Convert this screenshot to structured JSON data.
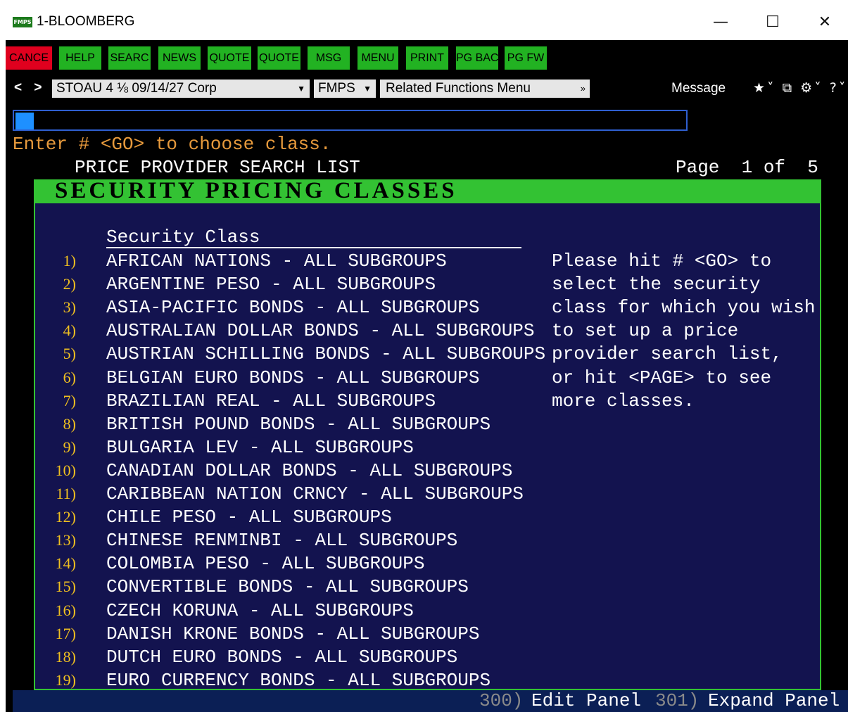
{
  "window": {
    "title": "1-BLOOMBERG",
    "icon_text": "FMPS",
    "controls": {
      "minimize": "—",
      "maximize": "☐",
      "close": "✕"
    }
  },
  "toolbar": {
    "buttons": [
      "CANCE",
      "HELP",
      "SEARC",
      "NEWS",
      "QUOTE",
      "QUOTE",
      "MSG",
      "MENU",
      "PRINT",
      "PG BAC",
      "PG FW"
    ]
  },
  "navbar": {
    "arrows": "< >",
    "security": "STOAU 4 ⅛ 09/14/27 Corp",
    "function": "FMPS",
    "related": "Related Functions  Menu",
    "message": "Message",
    "icons": "★˅ ⧉ ⚙˅ ?˅"
  },
  "screen": {
    "prompt": "Enter # <GO> to choose class.",
    "subtitle": "PRICE PROVIDER SEARCH LIST",
    "page_info": "Page  1 of  5",
    "banner": "SECURITY PRICING CLASSES",
    "column_header": "Security Class",
    "classes": [
      {
        "num": "1)",
        "label": "AFRICAN NATIONS - ALL SUBGROUPS"
      },
      {
        "num": "2)",
        "label": "ARGENTINE PESO - ALL SUBGROUPS"
      },
      {
        "num": "3)",
        "label": "ASIA-PACIFIC BONDS - ALL SUBGROUPS"
      },
      {
        "num": "4)",
        "label": "AUSTRALIAN DOLLAR BONDS - ALL SUBGROUPS"
      },
      {
        "num": "5)",
        "label": "AUSTRIAN SCHILLING BONDS - ALL SUBGROUPS"
      },
      {
        "num": "6)",
        "label": "BELGIAN EURO BONDS - ALL SUBGROUPS"
      },
      {
        "num": "7)",
        "label": "BRAZILIAN REAL - ALL SUBGROUPS"
      },
      {
        "num": "8)",
        "label": "BRITISH POUND BONDS - ALL SUBGROUPS"
      },
      {
        "num": "9)",
        "label": "BULGARIA LEV - ALL SUBGROUPS"
      },
      {
        "num": "10)",
        "label": "CANADIAN DOLLAR BONDS - ALL SUBGROUPS"
      },
      {
        "num": "11)",
        "label": "CARIBBEAN NATION CRNCY - ALL SUBGROUPS"
      },
      {
        "num": "12)",
        "label": "CHILE PESO - ALL SUBGROUPS"
      },
      {
        "num": "13)",
        "label": "CHINESE RENMINBI - ALL SUBGROUPS"
      },
      {
        "num": "14)",
        "label": "COLOMBIA PESO - ALL SUBGROUPS"
      },
      {
        "num": "15)",
        "label": "CONVERTIBLE BONDS - ALL SUBGROUPS"
      },
      {
        "num": "16)",
        "label": "CZECH KORUNA - ALL SUBGROUPS"
      },
      {
        "num": "17)",
        "label": "DANISH KRONE BONDS - ALL SUBGROUPS"
      },
      {
        "num": "18)",
        "label": "DUTCH EURO BONDS - ALL SUBGROUPS"
      },
      {
        "num": "19)",
        "label": "EURO CURRENCY BONDS - ALL SUBGROUPS"
      }
    ],
    "help_lines": [
      "Please hit # <GO> to",
      "select the security",
      "class for which you wish",
      "to set up a price",
      "provider search list,",
      "or hit <PAGE> to see",
      "more classes."
    ]
  },
  "footer": {
    "edit_num": "300)",
    "edit_label": "Edit Panel",
    "expand_num": "301)",
    "expand_label": "Expand Panel"
  },
  "colors": {
    "terminal_bg": "#000000",
    "panel_bg": "#13134f",
    "banner_green": "#33c233",
    "prompt_amber": "#e79a3c",
    "number_yellow": "#f0c020",
    "cancel_red": "#e0001e"
  }
}
